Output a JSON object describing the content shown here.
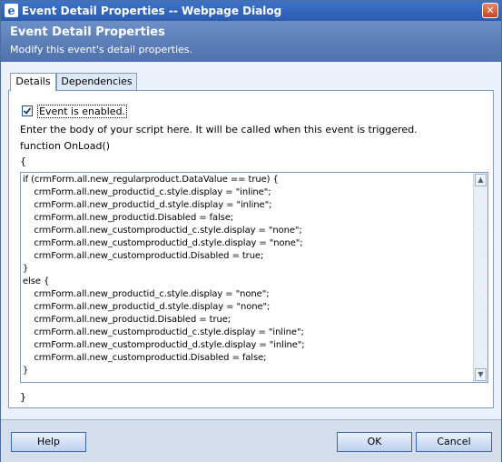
{
  "window": {
    "title": "Event Detail Properties -- Webpage Dialog",
    "close_glyph": "✕"
  },
  "header": {
    "title": "Event Detail Properties",
    "subtitle": "Modify this event's detail properties."
  },
  "tabs": [
    {
      "label": "Details",
      "active": true
    },
    {
      "label": "Dependencies",
      "active": false
    }
  ],
  "details": {
    "enabled_label": "Event is enabled.",
    "enabled_checked": true,
    "check_glyph": "✓",
    "description": "Enter the body of your script here. It will be called when this event is triggered.",
    "function_signature": "function OnLoad()",
    "brace_open": "{",
    "brace_close": "}",
    "script_body": "if (crmForm.all.new_regularproduct.DataValue == true) {\n    crmForm.all.new_productid_c.style.display = \"inline\";\n    crmForm.all.new_productid_d.style.display = \"inline\";\n    crmForm.all.new_productid.Disabled = false;\n    crmForm.all.new_customproductid_c.style.display = \"none\";\n    crmForm.all.new_customproductid_d.style.display = \"none\";\n    crmForm.all.new_customproductid.Disabled = true;\n}\nelse {\n    crmForm.all.new_productid_c.style.display = \"none\";\n    crmForm.all.new_productid_d.style.display = \"none\";\n    crmForm.all.new_productid.Disabled = true;\n    crmForm.all.new_customproductid_c.style.display = \"inline\";\n    crmForm.all.new_customproductid_d.style.display = \"inline\";\n    crmForm.all.new_customproductid.Disabled = false;\n}"
  },
  "scrollbar": {
    "up_glyph": "▲",
    "down_glyph": "▼"
  },
  "footer": {
    "help_label": "Help",
    "ok_label": "OK",
    "cancel_label": "Cancel"
  },
  "colors": {
    "title_bar": "#2a5bb0",
    "header": "#5b7fb9",
    "dialog_bg": "#eaf1fb",
    "footer_bg": "#d3ddec"
  }
}
